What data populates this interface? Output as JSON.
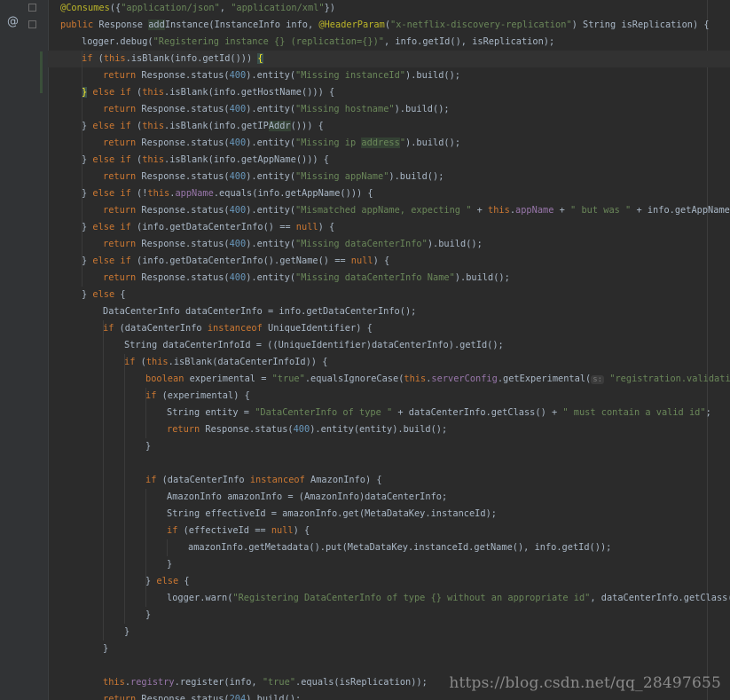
{
  "editor": {
    "gutter_icon": "@",
    "gutter_icon_name": "override-annotation-icon",
    "watermark": "https://blog.csdn.net/qq_28497655",
    "colors": {
      "background": "#2b2b2b",
      "keyword": "#cc7832",
      "string": "#6a8759",
      "number": "#6897bb",
      "annotation": "#bbb529",
      "field": "#9876aa",
      "text": "#a9b7c6"
    },
    "lines": [
      {
        "indent": 0,
        "tokens": [
          [
            "@Consumes",
            "ann"
          ],
          [
            "({",
            "plain"
          ],
          [
            "\"application/json\"",
            "str"
          ],
          [
            ", ",
            "plain"
          ],
          [
            "\"application/xml\"",
            "str"
          ],
          [
            "})",
            "plain"
          ]
        ]
      },
      {
        "indent": 0,
        "tokens": [
          [
            "public ",
            "kw"
          ],
          [
            "Response ",
            "plain"
          ],
          [
            "add",
            "hl"
          ],
          [
            "Instance(InstanceInfo info, ",
            "plain"
          ],
          [
            "@HeaderParam",
            "ann"
          ],
          [
            "(",
            "plain"
          ],
          [
            "\"x-netflix-discovery-replication\"",
            "str"
          ],
          [
            ") String isReplication) {",
            "plain"
          ]
        ]
      },
      {
        "indent": 1,
        "tokens": [
          [
            "logger",
            "plain"
          ],
          [
            ".debug(",
            "plain"
          ],
          [
            "\"Registering instance {} (replication={})\"",
            "str"
          ],
          [
            ", info.getId(), isReplication);",
            "plain"
          ]
        ]
      },
      {
        "indent": 1,
        "cursor": true,
        "tokens": [
          [
            "if ",
            "kw"
          ],
          [
            "(",
            "plain"
          ],
          [
            "this",
            "kw"
          ],
          [
            ".isBlank(info.getId())) ",
            "plain"
          ],
          [
            "{",
            "brace"
          ]
        ]
      },
      {
        "indent": 2,
        "tokens": [
          [
            "return ",
            "kw"
          ],
          [
            "Response.",
            "plain"
          ],
          [
            "status",
            "plain"
          ],
          [
            "(",
            "plain"
          ],
          [
            "400",
            "num"
          ],
          [
            ").entity(",
            "plain"
          ],
          [
            "\"Missing instanceId\"",
            "str"
          ],
          [
            ").build();",
            "plain"
          ]
        ]
      },
      {
        "indent": 1,
        "tokens": [
          [
            "}",
            "brace"
          ],
          [
            " else if ",
            "kw"
          ],
          [
            "(",
            "plain"
          ],
          [
            "this",
            "kw"
          ],
          [
            ".isBlank(info.getHostName())) {",
            "plain"
          ]
        ]
      },
      {
        "indent": 2,
        "tokens": [
          [
            "return ",
            "kw"
          ],
          [
            "Response.status(",
            "plain"
          ],
          [
            "400",
            "num"
          ],
          [
            ").entity(",
            "plain"
          ],
          [
            "\"Missing hostname\"",
            "str"
          ],
          [
            ").build();",
            "plain"
          ]
        ]
      },
      {
        "indent": 1,
        "tokens": [
          [
            "} ",
            "plain"
          ],
          [
            "else if ",
            "kw"
          ],
          [
            "(",
            "plain"
          ],
          [
            "this",
            "kw"
          ],
          [
            ".isBlank(info.getIP",
            "plain"
          ],
          [
            "Addr",
            "hl"
          ],
          [
            "())) {",
            "plain"
          ]
        ]
      },
      {
        "indent": 2,
        "tokens": [
          [
            "return ",
            "kw"
          ],
          [
            "Response.status(",
            "plain"
          ],
          [
            "400",
            "num"
          ],
          [
            ").entity(",
            "plain"
          ],
          [
            "\"Missing ip ",
            "str"
          ],
          [
            "address",
            "hlstr"
          ],
          [
            "\"",
            "str"
          ],
          [
            ").build();",
            "plain"
          ]
        ]
      },
      {
        "indent": 1,
        "tokens": [
          [
            "} ",
            "plain"
          ],
          [
            "else if ",
            "kw"
          ],
          [
            "(",
            "plain"
          ],
          [
            "this",
            "kw"
          ],
          [
            ".isBlank(info.getAppName())) {",
            "plain"
          ]
        ]
      },
      {
        "indent": 2,
        "tokens": [
          [
            "return ",
            "kw"
          ],
          [
            "Response.status(",
            "plain"
          ],
          [
            "400",
            "num"
          ],
          [
            ").entity(",
            "plain"
          ],
          [
            "\"Missing appName\"",
            "str"
          ],
          [
            ").build();",
            "plain"
          ]
        ]
      },
      {
        "indent": 1,
        "tokens": [
          [
            "} ",
            "plain"
          ],
          [
            "else if ",
            "kw"
          ],
          [
            "(!",
            "plain"
          ],
          [
            "this",
            "kw"
          ],
          [
            ".",
            "plain"
          ],
          [
            "appName",
            "fld"
          ],
          [
            ".equals(info.getAppName())) {",
            "plain"
          ]
        ]
      },
      {
        "indent": 2,
        "tokens": [
          [
            "return ",
            "kw"
          ],
          [
            "Response.status(",
            "plain"
          ],
          [
            "400",
            "num"
          ],
          [
            ").entity(",
            "plain"
          ],
          [
            "\"Mismatched appName, expecting \"",
            "str"
          ],
          [
            " + ",
            "plain"
          ],
          [
            "this",
            "kw"
          ],
          [
            ".",
            "plain"
          ],
          [
            "appName",
            "fld"
          ],
          [
            " + ",
            "plain"
          ],
          [
            "\" but was \"",
            "str"
          ],
          [
            " + info.getAppName()).build();",
            "plain"
          ]
        ]
      },
      {
        "indent": 1,
        "tokens": [
          [
            "} ",
            "plain"
          ],
          [
            "else if ",
            "kw"
          ],
          [
            "(info.getDataCenterInfo() == ",
            "plain"
          ],
          [
            "null",
            "kw"
          ],
          [
            ") {",
            "plain"
          ]
        ]
      },
      {
        "indent": 2,
        "tokens": [
          [
            "return ",
            "kw"
          ],
          [
            "Response.status(",
            "plain"
          ],
          [
            "400",
            "num"
          ],
          [
            ").entity(",
            "plain"
          ],
          [
            "\"Missing dataCenterInfo\"",
            "str"
          ],
          [
            ").build();",
            "plain"
          ]
        ]
      },
      {
        "indent": 1,
        "tokens": [
          [
            "} ",
            "plain"
          ],
          [
            "else if ",
            "kw"
          ],
          [
            "(info.getDataCenterInfo().getName() == ",
            "plain"
          ],
          [
            "null",
            "kw"
          ],
          [
            ") {",
            "plain"
          ]
        ]
      },
      {
        "indent": 2,
        "tokens": [
          [
            "return ",
            "kw"
          ],
          [
            "Response.status(",
            "plain"
          ],
          [
            "400",
            "num"
          ],
          [
            ").entity(",
            "plain"
          ],
          [
            "\"Missing dataCenterInfo Name\"",
            "str"
          ],
          [
            ").build();",
            "plain"
          ]
        ]
      },
      {
        "indent": 1,
        "tokens": [
          [
            "} ",
            "plain"
          ],
          [
            "else ",
            "kw"
          ],
          [
            "{",
            "plain"
          ]
        ]
      },
      {
        "indent": 2,
        "tokens": [
          [
            "DataCenterInfo dataCenterInfo = info.getDataCenterInfo();",
            "plain"
          ]
        ]
      },
      {
        "indent": 2,
        "tokens": [
          [
            "if ",
            "kw"
          ],
          [
            "(dataCenterInfo ",
            "plain"
          ],
          [
            "instanceof ",
            "kw"
          ],
          [
            "UniqueIdentifier) {",
            "plain"
          ]
        ]
      },
      {
        "indent": 3,
        "tokens": [
          [
            "String dataCenterInfoId = ((UniqueIdentifier)dataCenterInfo).getId();",
            "plain"
          ]
        ]
      },
      {
        "indent": 3,
        "tokens": [
          [
            "if ",
            "kw"
          ],
          [
            "(",
            "plain"
          ],
          [
            "this",
            "kw"
          ],
          [
            ".isBlank(dataCenterInfoId)) {",
            "plain"
          ]
        ]
      },
      {
        "indent": 4,
        "tokens": [
          [
            "boolean ",
            "kw"
          ],
          [
            "experimental = ",
            "plain"
          ],
          [
            "\"true\"",
            "str"
          ],
          [
            ".equalsIgnoreCase(",
            "plain"
          ],
          [
            "this",
            "kw"
          ],
          [
            ".",
            "plain"
          ],
          [
            "serverConfig",
            "fld"
          ],
          [
            ".getExperimental(",
            "plain"
          ],
          [
            "s:",
            "hint"
          ],
          [
            " ",
            "plain"
          ],
          [
            "\"registration.validation.dataCenterInfoId\"",
            "str"
          ],
          [
            "));",
            "plain"
          ]
        ]
      },
      {
        "indent": 4,
        "tokens": [
          [
            "if ",
            "kw"
          ],
          [
            "(experimental) {",
            "plain"
          ]
        ]
      },
      {
        "indent": 5,
        "tokens": [
          [
            "String entity = ",
            "plain"
          ],
          [
            "\"DataCenterInfo of type \"",
            "str"
          ],
          [
            " + dataCenterInfo.getClass() + ",
            "plain"
          ],
          [
            "\" must contain a valid id\"",
            "str"
          ],
          [
            ";",
            "plain"
          ]
        ]
      },
      {
        "indent": 5,
        "tokens": [
          [
            "return ",
            "kw"
          ],
          [
            "Response.status(",
            "plain"
          ],
          [
            "400",
            "num"
          ],
          [
            ").entity(entity).build();",
            "plain"
          ]
        ]
      },
      {
        "indent": 4,
        "tokens": [
          [
            "}",
            "plain"
          ]
        ]
      },
      {
        "indent": 0,
        "tokens": []
      },
      {
        "indent": 4,
        "tokens": [
          [
            "if ",
            "kw"
          ],
          [
            "(dataCenterInfo ",
            "plain"
          ],
          [
            "instanceof ",
            "kw"
          ],
          [
            "AmazonInfo) {",
            "plain"
          ]
        ]
      },
      {
        "indent": 5,
        "tokens": [
          [
            "AmazonInfo amazonInfo = (AmazonInfo)dataCenterInfo;",
            "plain"
          ]
        ]
      },
      {
        "indent": 5,
        "tokens": [
          [
            "String effectiveId = amazonInfo.get(MetaDataKey.",
            "plain"
          ],
          [
            "instanceId",
            "plain"
          ],
          [
            ");",
            "plain"
          ]
        ]
      },
      {
        "indent": 5,
        "tokens": [
          [
            "if ",
            "kw"
          ],
          [
            "(effectiveId == ",
            "plain"
          ],
          [
            "null",
            "kw"
          ],
          [
            ") {",
            "plain"
          ]
        ]
      },
      {
        "indent": 6,
        "tokens": [
          [
            "amazonInfo.getMetadata().put(MetaDataKey.",
            "plain"
          ],
          [
            "instanceId",
            "plain"
          ],
          [
            ".getName(), info.getId());",
            "plain"
          ]
        ]
      },
      {
        "indent": 5,
        "tokens": [
          [
            "}",
            "plain"
          ]
        ]
      },
      {
        "indent": 4,
        "tokens": [
          [
            "} ",
            "plain"
          ],
          [
            "else ",
            "kw"
          ],
          [
            "{",
            "plain"
          ]
        ]
      },
      {
        "indent": 5,
        "tokens": [
          [
            "logger",
            "plain"
          ],
          [
            ".warn(",
            "plain"
          ],
          [
            "\"Registering DataCenterInfo of type {} without an appropriate id\"",
            "str"
          ],
          [
            ", dataCenterInfo.getClass());",
            "plain"
          ]
        ]
      },
      {
        "indent": 4,
        "tokens": [
          [
            "}",
            "plain"
          ]
        ]
      },
      {
        "indent": 3,
        "tokens": [
          [
            "}",
            "plain"
          ]
        ]
      },
      {
        "indent": 2,
        "tokens": [
          [
            "}",
            "plain"
          ]
        ]
      },
      {
        "indent": 0,
        "tokens": []
      },
      {
        "indent": 2,
        "tokens": [
          [
            "this",
            "kw"
          ],
          [
            ".",
            "plain"
          ],
          [
            "registry",
            "fld"
          ],
          [
            ".register(info, ",
            "plain"
          ],
          [
            "\"true\"",
            "str"
          ],
          [
            ".equals(isReplication));",
            "plain"
          ]
        ]
      },
      {
        "indent": 2,
        "tokens": [
          [
            "return ",
            "kw"
          ],
          [
            "Response.status(",
            "plain"
          ],
          [
            "204",
            "num"
          ],
          [
            ").build();",
            "plain"
          ]
        ]
      }
    ]
  }
}
